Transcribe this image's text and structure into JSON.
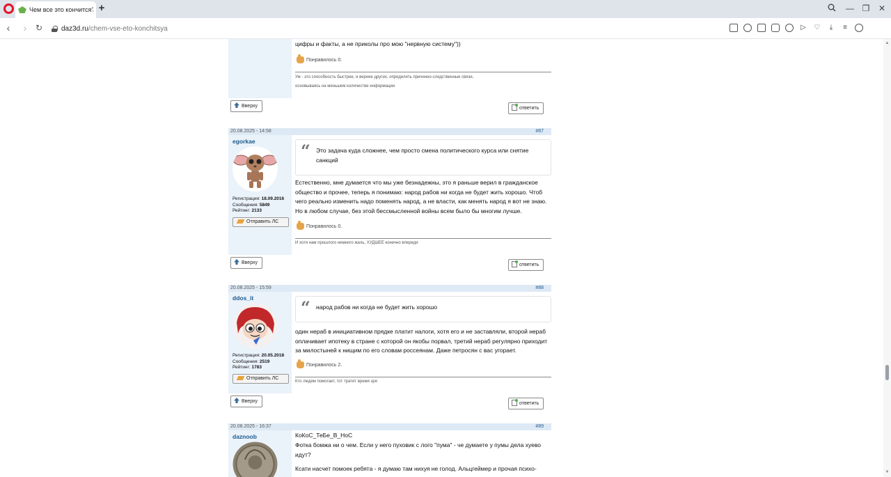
{
  "browser": {
    "tab_title": "Чем все это кончится? | D",
    "url_domain": "daz3d.ru",
    "url_path": "/chem-vse-eto-konchitsya"
  },
  "labels": {
    "top_button": "Вверху",
    "reply_button": "ответить",
    "pm_button": "Отправить ЛС",
    "reg_label": "Регистрация:",
    "msgs_label": "Сообщения:",
    "rating_label": "Рейтинг:"
  },
  "top_fragment": {
    "text": "цифры и факты, а не приколы про мою \"нервную систему\"))",
    "likes": "Понравилось 0.",
    "signature_line1": "Ум - это способность быстрее, и вернее других, определить причинно-следственные связи,",
    "signature_line2": "основываясь на меньшем количестве информации"
  },
  "posts": [
    {
      "date": "20.08.2025 - 14:58",
      "number": "#87",
      "username": "egorkae",
      "registration": "18.09.2016",
      "messages": "5849",
      "rating": "2133",
      "quote": "Это задача куда сложнее, чем просто смена политического курса или снятие санкций",
      "text": "Естественно, мне думается что мы уже безнадежны, это я раньше верил в гражданское общество и прочее, теперь я понимаю: народ рабов ни когда не будет жить хорошо. Чтоб чего реально изменить надо поменять народ, а не власти, как менять народ я вот не знаю. Но в любом случае, без этой бессмысленной войны всем было бы многим лучше.",
      "likes": "Понравилось 0.",
      "signature": "И хотя нам прошлого немного жаль, ХУДШЕЕ конечно впереди"
    },
    {
      "date": "20.08.2025 - 15:59",
      "number": "#88",
      "username": "ddos_it",
      "registration": "20.05.2018",
      "messages": "2519",
      "rating": "1783",
      "quote": "народ рабов ни когда не будет жить хорошо",
      "text": "один нераб в инициативном прядке платит налоги, хотя его и не заставляли, второй нераб оплачивает ипотеку в стране с которой он якобы порвал, третий нераб регулярно приходит за милостыней к нищим по его словам россеянам. Даже петросян с вас угорает.",
      "likes": "Понравилось 2.",
      "signature": "Кто людям помогает, тот тратит время зря"
    },
    {
      "date": "20.08.2025 - 16:37",
      "number": "#89",
      "username": "daznoob",
      "line1": "КоКоС_ТеБе_В_НоС",
      "line2": "Фотка бомжа ни о чем. Если у него пуховик с лого \"пума\" - че думаете у пумы дела хуево идут?",
      "line3": "Ксати насчет помоек ребята - я думаю там нихуя не голод. Альцгеймер и прочая психо-"
    }
  ]
}
